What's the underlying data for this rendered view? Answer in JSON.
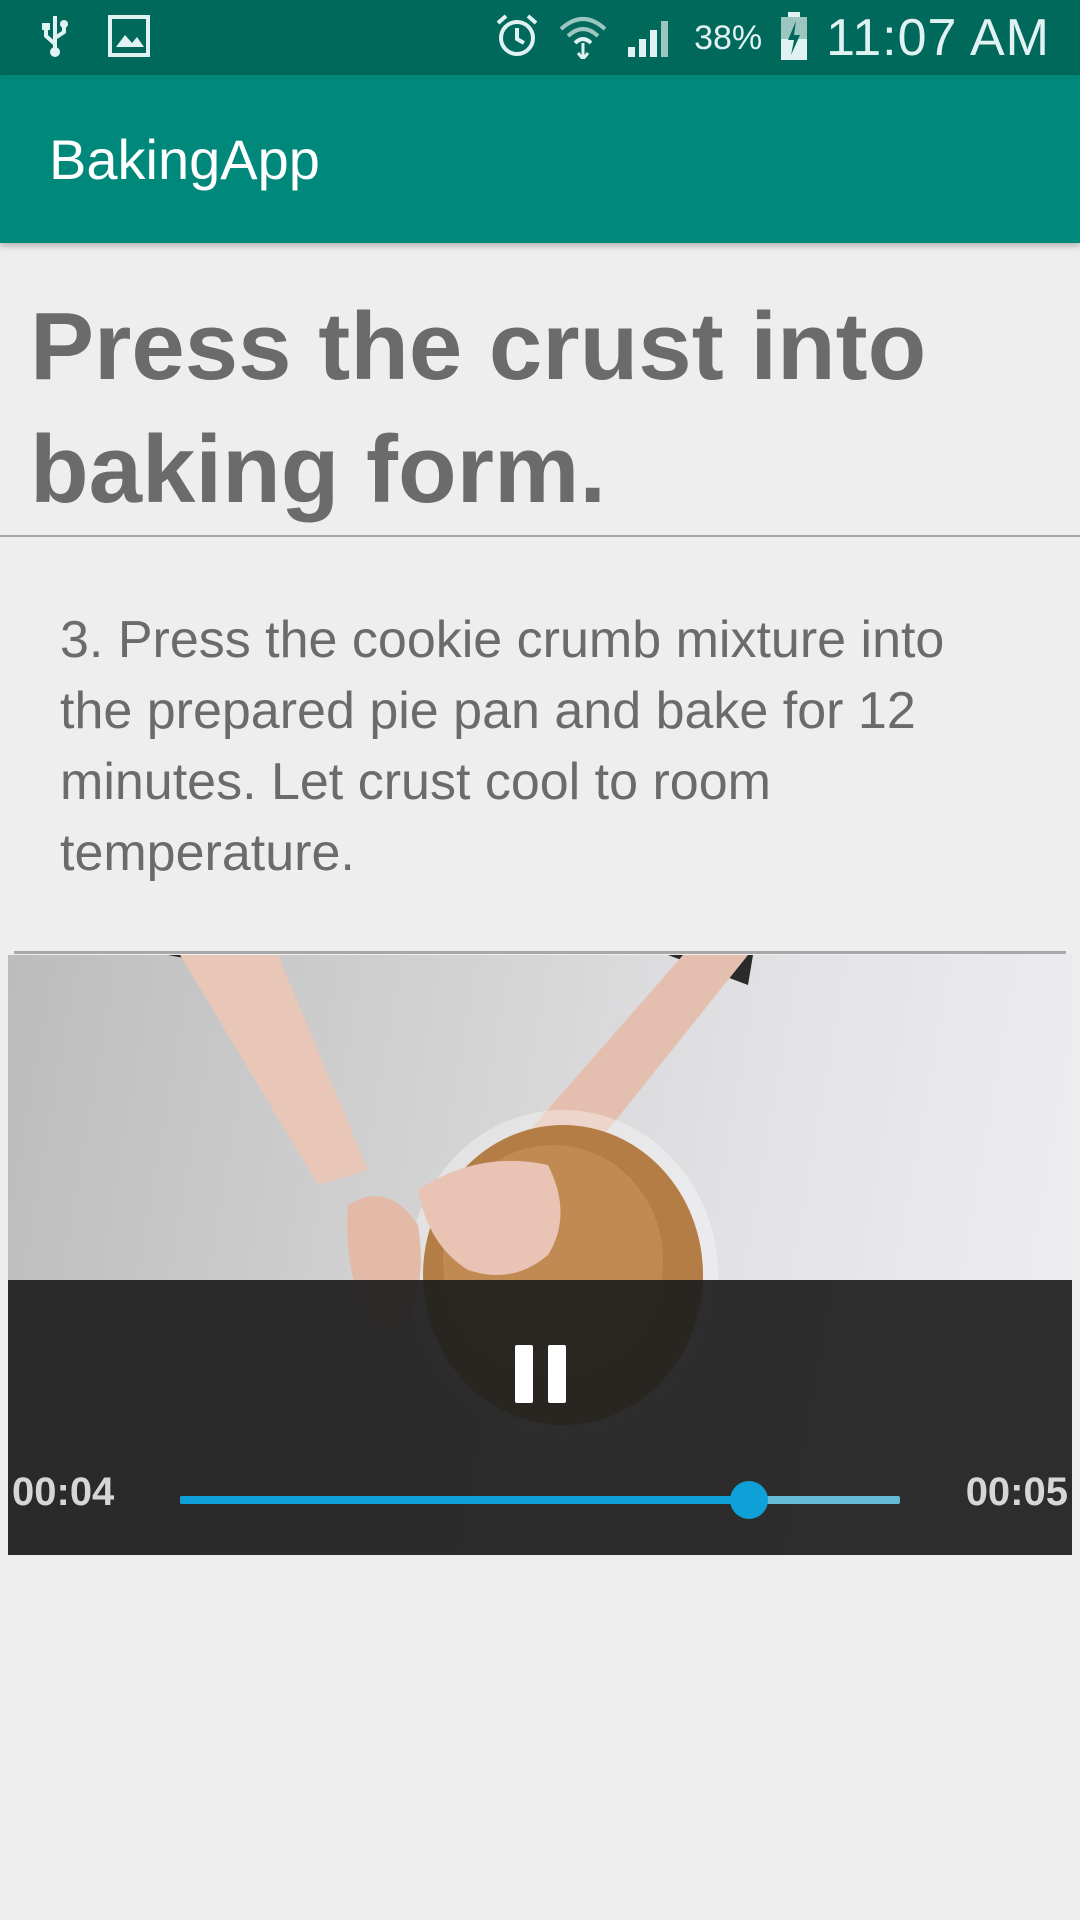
{
  "status_bar": {
    "icons_left": [
      "usb-icon",
      "image-icon"
    ],
    "icons_right": [
      "alarm-icon",
      "wifi-icon",
      "signal-icon",
      "battery-charging-icon"
    ],
    "battery_percent": "38%",
    "time": "11:07 AM"
  },
  "app_bar": {
    "title": "BakingApp",
    "color": "#00897b"
  },
  "step": {
    "short_description": "Press the crust into baking form.",
    "description": "3. Press the cookie crumb mixture into the prepared pie pan and bake for 12 minutes. Let crust cool to room temperature."
  },
  "player": {
    "state_icon": "pause-icon",
    "position": "00:04",
    "duration": "00:05",
    "progress_fraction": 0.79,
    "accent_color": "#0fa0d8"
  }
}
